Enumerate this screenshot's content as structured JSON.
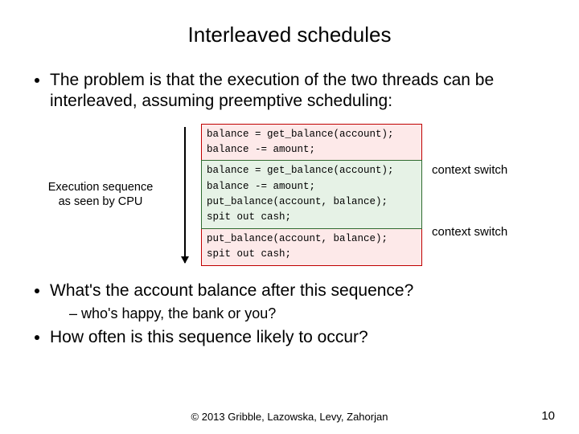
{
  "title": "Interleaved schedules",
  "bullet1": "The problem is that the execution of the two threads can be interleaved, assuming preemptive scheduling:",
  "leftCaption": "Execution sequence\nas seen by CPU",
  "code": {
    "red1": "balance = get_balance(account);\nbalance -= amount;",
    "green": "balance = get_balance(account);\nbalance -= amount;\nput_balance(account, balance);\nspit out cash;",
    "red2": "put_balance(account, balance);\nspit out cash;"
  },
  "cs1": "context switch",
  "cs2": "context switch",
  "bullet2": "What's the account balance after this sequence?",
  "bullet2sub": "who's happy, the bank or you?",
  "bullet3": "How often is this sequence likely to occur?",
  "footer": "© 2013 Gribble, Lazowska, Levy, Zahorjan",
  "pageNum": "10"
}
